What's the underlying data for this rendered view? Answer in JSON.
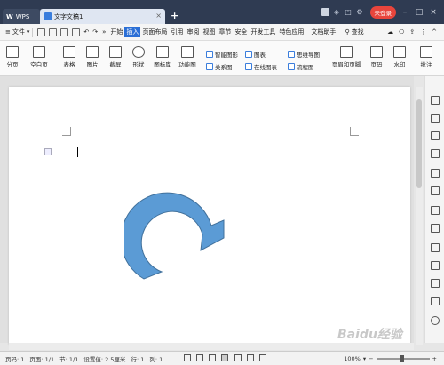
{
  "titlebar": {
    "app_tab": "WPS",
    "doc_tab": "文字文稿1",
    "tab_close": "×",
    "new_tab": "+",
    "login": "未登录"
  },
  "menubar": {
    "file": "文件",
    "items": [
      "开始",
      "插入",
      "页面布局",
      "引用",
      "审阅",
      "视图",
      "章节",
      "安全",
      "开发工具",
      "特色应用",
      "文档助手"
    ],
    "active_index": 1,
    "search": "查找"
  },
  "ribbon": {
    "page_break": "分页",
    "blank_page": "空白页",
    "table": "表格",
    "picture": "图片",
    "screenshot": "截屏",
    "shape": "形状",
    "icon_lib": "图标库",
    "func_chart": "功能图",
    "smart_art": "智能图形",
    "relation": "关系图",
    "chart": "图表",
    "online_chart": "在线图表",
    "mind_map": "思维导图",
    "flowchart": "流程图",
    "header_footer": "页眉和页脚",
    "page_num": "页码",
    "watermark": "水印",
    "comment": "批注"
  },
  "status": {
    "page": "页码: 1",
    "pages": "页面: 1/1",
    "section": "节: 1/1",
    "setting": "设置值: 2.5厘米",
    "row": "行: 1",
    "col": "列: 1",
    "zoom": "100%"
  },
  "watermark": "Baidu经验",
  "colors": {
    "title_bg": "#2f3b52",
    "accent": "#2b6fd6",
    "arrow": "#5b9bd5",
    "arrow_stroke": "#41719c"
  }
}
